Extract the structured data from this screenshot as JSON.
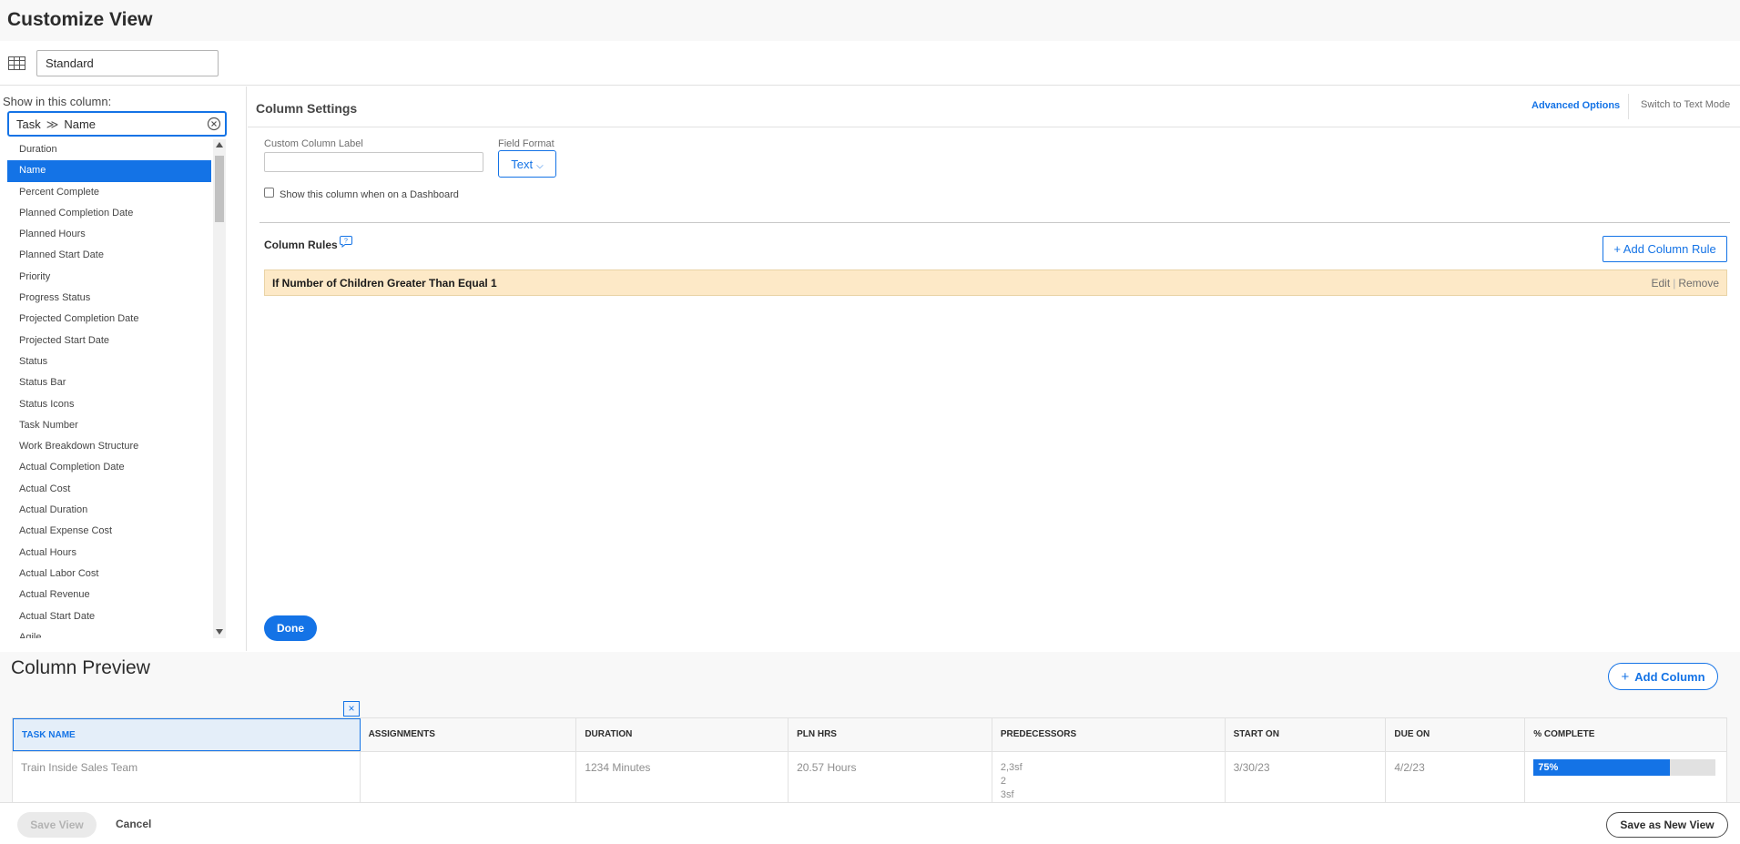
{
  "page": {
    "title": "Customize View"
  },
  "view": {
    "name": "Standard"
  },
  "left": {
    "show_label": "Show in this column:",
    "object": "Task",
    "separator": "≫",
    "field": "Name",
    "items": [
      "Duration",
      "Name",
      "Percent Complete",
      "Planned Completion Date",
      "Planned Hours",
      "Planned Start Date",
      "Priority",
      "Progress Status",
      "Projected Completion Date",
      "Projected Start Date",
      "Status",
      "Status Bar",
      "Status Icons",
      "Task Number",
      "Work Breakdown Structure",
      "Actual Completion Date",
      "Actual Cost",
      "Actual Duration",
      "Actual Expense Cost",
      "Actual Hours",
      "Actual Labor Cost",
      "Actual Revenue",
      "Actual Start Date",
      "Agile"
    ],
    "selected_index": 1
  },
  "settings": {
    "title": "Column Settings",
    "advanced": "Advanced Options",
    "text_mode": "Switch to Text Mode",
    "custom_label": "Custom Column Label",
    "custom_label_value": "",
    "field_format_label": "Field Format",
    "field_format_value": "Text",
    "dashboard_label": "Show this column when on a Dashboard",
    "dashboard_checked": false
  },
  "rules": {
    "title": "Column Rules",
    "add": "+ Add Column Rule",
    "rule_text": "If Number of Children Greater Than Equal 1",
    "edit": "Edit",
    "separator": "|",
    "remove": "Remove"
  },
  "done": "Done",
  "preview": {
    "title": "Column Preview",
    "add_column": "Add Column",
    "add_column_plus": "+",
    "close": "×",
    "headers": [
      "TASK NAME",
      "ASSIGNMENTS",
      "DURATION",
      "PLN HRS",
      "PREDECESSORS",
      "START ON",
      "DUE ON",
      "% COMPLETE"
    ],
    "row": {
      "task_name": "Train Inside Sales Team",
      "assignments": "",
      "duration": "1234 Minutes",
      "pln_hrs": "20.57 Hours",
      "predecessors": [
        "2,3sf",
        "2",
        "3sf"
      ],
      "start_on": "3/30/23",
      "due_on": "4/2/23",
      "percent_complete_label": "75%",
      "percent_complete": 75
    }
  },
  "footer": {
    "save_view": "Save View",
    "cancel": "Cancel",
    "save_new": "Save as New View"
  },
  "colors": {
    "accent": "#1473e6",
    "rule_bg": "#fde9c7"
  }
}
